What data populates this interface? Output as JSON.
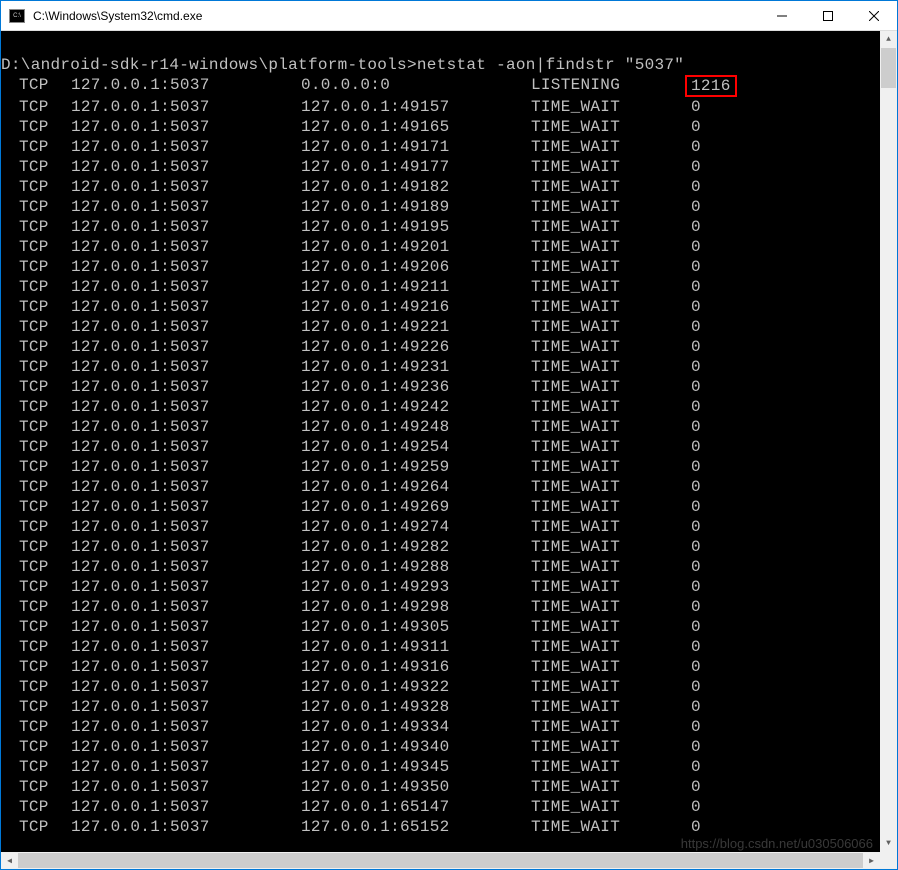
{
  "window": {
    "title": "C:\\Windows\\System32\\cmd.exe"
  },
  "prompt": {
    "path": "D:\\android-sdk-r14-windows\\platform-tools>",
    "command": "netstat -aon|findstr \"5037\""
  },
  "rows": [
    {
      "proto": "TCP",
      "local": "127.0.0.1:5037",
      "foreign": "0.0.0.0:0",
      "state": "LISTENING",
      "pid": "1216",
      "highlight": true
    },
    {
      "proto": "TCP",
      "local": "127.0.0.1:5037",
      "foreign": "127.0.0.1:49157",
      "state": "TIME_WAIT",
      "pid": "0"
    },
    {
      "proto": "TCP",
      "local": "127.0.0.1:5037",
      "foreign": "127.0.0.1:49165",
      "state": "TIME_WAIT",
      "pid": "0"
    },
    {
      "proto": "TCP",
      "local": "127.0.0.1:5037",
      "foreign": "127.0.0.1:49171",
      "state": "TIME_WAIT",
      "pid": "0"
    },
    {
      "proto": "TCP",
      "local": "127.0.0.1:5037",
      "foreign": "127.0.0.1:49177",
      "state": "TIME_WAIT",
      "pid": "0"
    },
    {
      "proto": "TCP",
      "local": "127.0.0.1:5037",
      "foreign": "127.0.0.1:49182",
      "state": "TIME_WAIT",
      "pid": "0"
    },
    {
      "proto": "TCP",
      "local": "127.0.0.1:5037",
      "foreign": "127.0.0.1:49189",
      "state": "TIME_WAIT",
      "pid": "0"
    },
    {
      "proto": "TCP",
      "local": "127.0.0.1:5037",
      "foreign": "127.0.0.1:49195",
      "state": "TIME_WAIT",
      "pid": "0"
    },
    {
      "proto": "TCP",
      "local": "127.0.0.1:5037",
      "foreign": "127.0.0.1:49201",
      "state": "TIME_WAIT",
      "pid": "0"
    },
    {
      "proto": "TCP",
      "local": "127.0.0.1:5037",
      "foreign": "127.0.0.1:49206",
      "state": "TIME_WAIT",
      "pid": "0"
    },
    {
      "proto": "TCP",
      "local": "127.0.0.1:5037",
      "foreign": "127.0.0.1:49211",
      "state": "TIME_WAIT",
      "pid": "0"
    },
    {
      "proto": "TCP",
      "local": "127.0.0.1:5037",
      "foreign": "127.0.0.1:49216",
      "state": "TIME_WAIT",
      "pid": "0"
    },
    {
      "proto": "TCP",
      "local": "127.0.0.1:5037",
      "foreign": "127.0.0.1:49221",
      "state": "TIME_WAIT",
      "pid": "0"
    },
    {
      "proto": "TCP",
      "local": "127.0.0.1:5037",
      "foreign": "127.0.0.1:49226",
      "state": "TIME_WAIT",
      "pid": "0"
    },
    {
      "proto": "TCP",
      "local": "127.0.0.1:5037",
      "foreign": "127.0.0.1:49231",
      "state": "TIME_WAIT",
      "pid": "0"
    },
    {
      "proto": "TCP",
      "local": "127.0.0.1:5037",
      "foreign": "127.0.0.1:49236",
      "state": "TIME_WAIT",
      "pid": "0"
    },
    {
      "proto": "TCP",
      "local": "127.0.0.1:5037",
      "foreign": "127.0.0.1:49242",
      "state": "TIME_WAIT",
      "pid": "0"
    },
    {
      "proto": "TCP",
      "local": "127.0.0.1:5037",
      "foreign": "127.0.0.1:49248",
      "state": "TIME_WAIT",
      "pid": "0"
    },
    {
      "proto": "TCP",
      "local": "127.0.0.1:5037",
      "foreign": "127.0.0.1:49254",
      "state": "TIME_WAIT",
      "pid": "0"
    },
    {
      "proto": "TCP",
      "local": "127.0.0.1:5037",
      "foreign": "127.0.0.1:49259",
      "state": "TIME_WAIT",
      "pid": "0"
    },
    {
      "proto": "TCP",
      "local": "127.0.0.1:5037",
      "foreign": "127.0.0.1:49264",
      "state": "TIME_WAIT",
      "pid": "0"
    },
    {
      "proto": "TCP",
      "local": "127.0.0.1:5037",
      "foreign": "127.0.0.1:49269",
      "state": "TIME_WAIT",
      "pid": "0"
    },
    {
      "proto": "TCP",
      "local": "127.0.0.1:5037",
      "foreign": "127.0.0.1:49274",
      "state": "TIME_WAIT",
      "pid": "0"
    },
    {
      "proto": "TCP",
      "local": "127.0.0.1:5037",
      "foreign": "127.0.0.1:49282",
      "state": "TIME_WAIT",
      "pid": "0"
    },
    {
      "proto": "TCP",
      "local": "127.0.0.1:5037",
      "foreign": "127.0.0.1:49288",
      "state": "TIME_WAIT",
      "pid": "0"
    },
    {
      "proto": "TCP",
      "local": "127.0.0.1:5037",
      "foreign": "127.0.0.1:49293",
      "state": "TIME_WAIT",
      "pid": "0"
    },
    {
      "proto": "TCP",
      "local": "127.0.0.1:5037",
      "foreign": "127.0.0.1:49298",
      "state": "TIME_WAIT",
      "pid": "0"
    },
    {
      "proto": "TCP",
      "local": "127.0.0.1:5037",
      "foreign": "127.0.0.1:49305",
      "state": "TIME_WAIT",
      "pid": "0"
    },
    {
      "proto": "TCP",
      "local": "127.0.0.1:5037",
      "foreign": "127.0.0.1:49311",
      "state": "TIME_WAIT",
      "pid": "0"
    },
    {
      "proto": "TCP",
      "local": "127.0.0.1:5037",
      "foreign": "127.0.0.1:49316",
      "state": "TIME_WAIT",
      "pid": "0"
    },
    {
      "proto": "TCP",
      "local": "127.0.0.1:5037",
      "foreign": "127.0.0.1:49322",
      "state": "TIME_WAIT",
      "pid": "0"
    },
    {
      "proto": "TCP",
      "local": "127.0.0.1:5037",
      "foreign": "127.0.0.1:49328",
      "state": "TIME_WAIT",
      "pid": "0"
    },
    {
      "proto": "TCP",
      "local": "127.0.0.1:5037",
      "foreign": "127.0.0.1:49334",
      "state": "TIME_WAIT",
      "pid": "0"
    },
    {
      "proto": "TCP",
      "local": "127.0.0.1:5037",
      "foreign": "127.0.0.1:49340",
      "state": "TIME_WAIT",
      "pid": "0"
    },
    {
      "proto": "TCP",
      "local": "127.0.0.1:5037",
      "foreign": "127.0.0.1:49345",
      "state": "TIME_WAIT",
      "pid": "0"
    },
    {
      "proto": "TCP",
      "local": "127.0.0.1:5037",
      "foreign": "127.0.0.1:49350",
      "state": "TIME_WAIT",
      "pid": "0"
    },
    {
      "proto": "TCP",
      "local": "127.0.0.1:5037",
      "foreign": "127.0.0.1:65147",
      "state": "TIME_WAIT",
      "pid": "0"
    },
    {
      "proto": "TCP",
      "local": "127.0.0.1:5037",
      "foreign": "127.0.0.1:65152",
      "state": "TIME_WAIT",
      "pid": "0"
    }
  ],
  "watermark": "https://blog.csdn.net/u030506066"
}
